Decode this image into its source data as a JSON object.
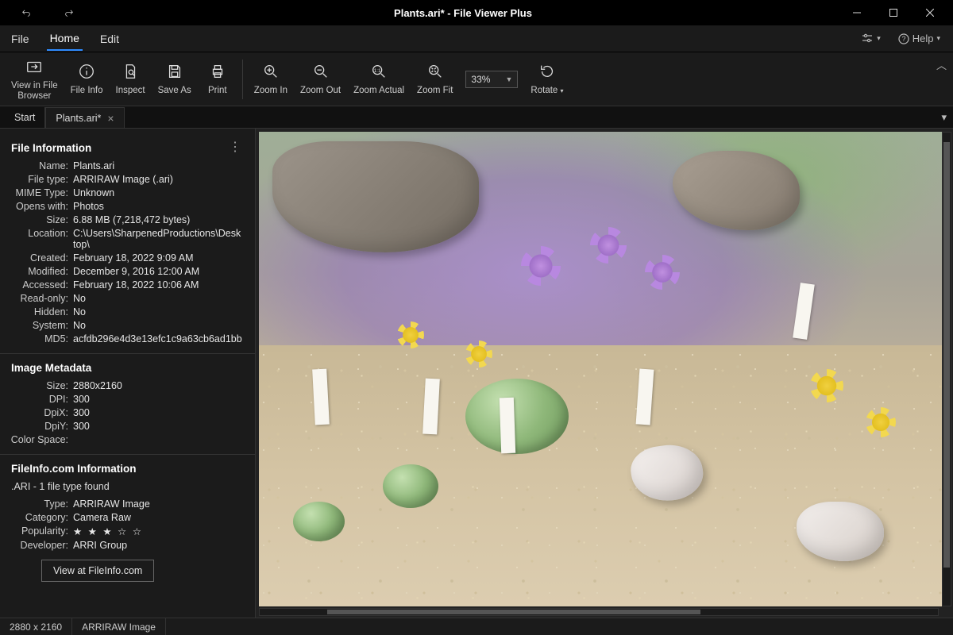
{
  "window": {
    "title": "Plants.ari* - File Viewer Plus"
  },
  "menubar": {
    "file": "File",
    "home": "Home",
    "edit": "Edit",
    "help": "Help"
  },
  "toolbar": {
    "view_in_browser": "View in File\nBrowser",
    "file_info": "File Info",
    "inspect": "Inspect",
    "save_as": "Save As",
    "print": "Print",
    "zoom_in": "Zoom In",
    "zoom_out": "Zoom Out",
    "zoom_actual": "Zoom Actual",
    "zoom_fit": "Zoom Fit",
    "zoom_value": "33%",
    "rotate": "Rotate"
  },
  "tabs": {
    "start": "Start",
    "file": "Plants.ari*"
  },
  "panel_file_info": {
    "title": "File Information",
    "name_k": "Name:",
    "name_v": "Plants.ari",
    "filetype_k": "File type:",
    "filetype_v": "ARRIRAW Image (.ari)",
    "mime_k": "MIME Type:",
    "mime_v": "Unknown",
    "opens_k": "Opens with:",
    "opens_v": "Photos",
    "size_k": "Size:",
    "size_v": "6.88 MB (7,218,472 bytes)",
    "location_k": "Location:",
    "location_v": "C:\\Users\\SharpenedProductions\\Desktop\\",
    "created_k": "Created:",
    "created_v": "February 18, 2022 9:09 AM",
    "modified_k": "Modified:",
    "modified_v": "December 9, 2016 12:00 AM",
    "accessed_k": "Accessed:",
    "accessed_v": "February 18, 2022 10:06 AM",
    "readonly_k": "Read-only:",
    "readonly_v": "No",
    "hidden_k": "Hidden:",
    "hidden_v": "No",
    "system_k": "System:",
    "system_v": "No",
    "md5_k": "MD5:",
    "md5_v": "acfdb296e4d3e13efc1c9a63cb6ad1bb"
  },
  "panel_image_meta": {
    "title": "Image Metadata",
    "size_k": "Size:",
    "size_v": "2880x2160",
    "dpi_k": "DPI:",
    "dpi_v": "300",
    "dpix_k": "DpiX:",
    "dpix_v": "300",
    "dpiy_k": "DpiY:",
    "dpiy_v": "300",
    "colorspace_k": "Color Space:",
    "colorspace_v": ""
  },
  "panel_fileinfo_com": {
    "title": "FileInfo.com Information",
    "subnote": ".ARI - 1 file type found",
    "type_k": "Type:",
    "type_v": "ARRIRAW Image",
    "category_k": "Category:",
    "category_v": "Camera Raw",
    "popularity_k": "Popularity:",
    "popularity_v": "★ ★ ★ ☆ ☆",
    "developer_k": "Developer:",
    "developer_v": "ARRI Group",
    "link_button": "View at FileInfo.com"
  },
  "statusbar": {
    "dimensions": "2880 x 2160",
    "format": "ARRIRAW Image"
  }
}
